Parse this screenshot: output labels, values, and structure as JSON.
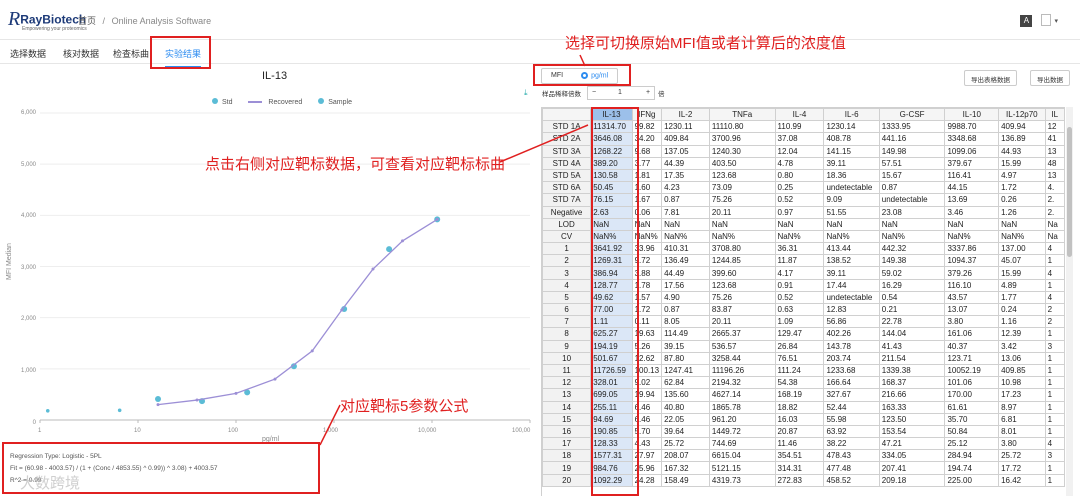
{
  "header": {
    "logo_brand": "RayBiotech",
    "logo_tagline": "Empowering your proteomics",
    "breadcrumb_home": "首页",
    "breadcrumb_sep": "/",
    "breadcrumb_page": "Online Analysis Software",
    "lang_icon": "A"
  },
  "tabs": [
    {
      "label": "选择数据"
    },
    {
      "label": "核对数据"
    },
    {
      "label": "检查标曲"
    },
    {
      "label": "实验结果"
    }
  ],
  "annotations": {
    "top": "选择可切换原始MFI值或者计算后的浓度值",
    "middle": "点击右侧对应靶标数据，可查看对应靶标标曲",
    "bottom": "对应靶标5参数公式"
  },
  "chart": {
    "title": "IL-13",
    "legend": [
      "Std",
      "Recovered",
      "Sample"
    ],
    "ylabel": "MFI Median",
    "xlabel": "pg/ml",
    "yticks": [
      "6,000",
      "5,000",
      "4,000",
      "3,000",
      "2,000",
      "1,000",
      "0"
    ],
    "xticks": [
      "1",
      "10",
      "100",
      "1,000",
      "10,000",
      "100,00"
    ]
  },
  "chart_data": {
    "type": "scatter",
    "title": "IL-13",
    "xlabel": "pg/ml",
    "ylabel": "MFI Median",
    "xscale": "log",
    "xlim": [
      1,
      100000
    ],
    "ylim": [
      0,
      6000
    ],
    "legend": "top",
    "series": [
      {
        "name": "Std",
        "x": [
          16,
          45,
          130,
          390,
          1270,
          3650,
          11300
        ],
        "y": [
          410,
          370,
          540,
          1050,
          2170,
          3340,
          3920
        ]
      },
      {
        "name": "Sample",
        "x": [
          1.2,
          6.5
        ],
        "y": [
          180,
          190
        ]
      },
      {
        "name": "Recovered",
        "x": [
          16,
          40,
          100,
          250,
          600,
          1200,
          2500,
          5000,
          11300
        ],
        "y": [
          300,
          390,
          520,
          800,
          1350,
          2150,
          2950,
          3500,
          3920
        ]
      }
    ]
  },
  "regression": {
    "type": "Regression Type: Logistic - 5PL",
    "formula": "Fit = (60.98 - 4003.57) / (1 + (Conc / 4853.55) ^ 0.99)) ^ 3.08) + 4003.57",
    "r2": "R^2 = 0.99"
  },
  "toggle": {
    "mfi": "MFI",
    "conc": "pg/ml"
  },
  "buttons": {
    "export_table": "导出表格数据",
    "export_graph": "导出数据"
  },
  "dilution": {
    "label": "样品稀释倍数",
    "minus": "−",
    "value": "1",
    "plus": "+",
    "unit": "倍"
  },
  "table": {
    "columns": [
      "",
      "IL-13",
      "IFNg",
      "IL-2",
      "TNFa",
      "IL-4",
      "IL-6",
      "G-CSF",
      "IL-10",
      "IL-12p70",
      "IL"
    ],
    "rows": [
      [
        "STD 1A",
        "11314.70",
        "99.82",
        "1230.11",
        "11110.80",
        "110.99",
        "1230.14",
        "1333.95",
        "9988.70",
        "409.94",
        "12"
      ],
      [
        "STD 2A",
        "3646.08",
        "34.20",
        "409.84",
        "3700.96",
        "37.08",
        "408.78",
        "441.16",
        "3348.68",
        "136.89",
        "41"
      ],
      [
        "STD 3A",
        "1268.22",
        "9.68",
        "137.05",
        "1240.30",
        "12.04",
        "141.15",
        "149.98",
        "1099.06",
        "44.93",
        "13"
      ],
      [
        "STD 4A",
        "389.20",
        "3.77",
        "44.39",
        "403.50",
        "4.78",
        "39.11",
        "57.51",
        "379.67",
        "15.99",
        "48"
      ],
      [
        "STD 5A",
        "130.58",
        "1.81",
        "17.35",
        "123.68",
        "0.80",
        "18.36",
        "15.67",
        "116.41",
        "4.97",
        "13"
      ],
      [
        "STD 6A",
        "50.45",
        "1.60",
        "4.23",
        "73.09",
        "0.25",
        "undetectable",
        "0.87",
        "44.15",
        "1.72",
        "4."
      ],
      [
        "STD 7A",
        "76.15",
        "1.67",
        "0.87",
        "75.26",
        "0.52",
        "9.09",
        "undetectable",
        "13.69",
        "0.26",
        "2."
      ],
      [
        "Negative",
        "2.63",
        "0.06",
        "7.81",
        "20.11",
        "0.97",
        "51.55",
        "23.08",
        "3.46",
        "1.26",
        "2."
      ],
      [
        "LOD",
        "NaN",
        "NaN",
        "NaN",
        "NaN",
        "NaN",
        "NaN",
        "NaN",
        "NaN",
        "NaN",
        "Na"
      ],
      [
        "CV",
        "NaN%",
        "NaN%",
        "NaN%",
        "NaN%",
        "NaN%",
        "NaN%",
        "NaN%",
        "NaN%",
        "NaN%",
        "Na"
      ],
      [
        "1",
        "3641.92",
        "33.96",
        "410.31",
        "3708.80",
        "36.31",
        "413.44",
        "442.32",
        "3337.86",
        "137.00",
        "4"
      ],
      [
        "2",
        "1269.31",
        "9.72",
        "136.49",
        "1244.85",
        "11.87",
        "138.52",
        "149.38",
        "1094.37",
        "45.07",
        "1"
      ],
      [
        "3",
        "386.94",
        "3.88",
        "44.49",
        "399.60",
        "4.17",
        "39.11",
        "59.02",
        "379.26",
        "15.99",
        "4"
      ],
      [
        "4",
        "128.77",
        "1.78",
        "17.56",
        "123.68",
        "0.91",
        "17.44",
        "16.29",
        "116.10",
        "4.89",
        "1"
      ],
      [
        "5",
        "49.62",
        "1.57",
        "4.90",
        "75.26",
        "0.52",
        "undetectable",
        "0.54",
        "43.57",
        "1.77",
        "4"
      ],
      [
        "6",
        "77.00",
        "1.72",
        "0.87",
        "83.87",
        "0.63",
        "12.83",
        "0.21",
        "13.07",
        "0.24",
        "2"
      ],
      [
        "7",
        "1.11",
        "0.11",
        "8.05",
        "20.11",
        "1.09",
        "56.86",
        "22.78",
        "3.80",
        "1.16",
        "2"
      ],
      [
        "8",
        "625.27",
        "19.63",
        "114.49",
        "2665.37",
        "129.47",
        "402.26",
        "144.04",
        "161.06",
        "12.39",
        "1"
      ],
      [
        "9",
        "194.19",
        "5.26",
        "39.15",
        "536.57",
        "26.84",
        "143.78",
        "41.43",
        "40.37",
        "3.42",
        "3"
      ],
      [
        "10",
        "501.67",
        "12.62",
        "87.80",
        "3258.44",
        "76.51",
        "203.74",
        "211.54",
        "123.71",
        "13.06",
        "1"
      ],
      [
        "11",
        "11726.59",
        "100.13",
        "1247.41",
        "11196.26",
        "111.24",
        "1233.68",
        "1339.38",
        "10052.19",
        "409.85",
        "1"
      ],
      [
        "12",
        "328.01",
        "9.02",
        "62.84",
        "2194.32",
        "54.38",
        "166.64",
        "168.37",
        "101.06",
        "10.98",
        "1"
      ],
      [
        "13",
        "699.05",
        "19.94",
        "135.60",
        "4627.14",
        "168.19",
        "327.67",
        "216.66",
        "170.00",
        "17.23",
        "1"
      ],
      [
        "14",
        "255.11",
        "6.46",
        "40.80",
        "1865.78",
        "18.82",
        "52.44",
        "163.33",
        "61.61",
        "8.97",
        "1"
      ],
      [
        "15",
        "94.69",
        "6.46",
        "22.05",
        "961.20",
        "16.03",
        "55.98",
        "123.50",
        "35.70",
        "6.81",
        "1"
      ],
      [
        "16",
        "190.85",
        "5.70",
        "39.64",
        "1449.72",
        "20.87",
        "63.92",
        "153.54",
        "50.84",
        "8.01",
        "1"
      ],
      [
        "17",
        "128.33",
        "4.43",
        "25.72",
        "744.69",
        "11.46",
        "38.22",
        "47.21",
        "25.12",
        "3.80",
        "4"
      ],
      [
        "18",
        "1577.31",
        "27.97",
        "208.07",
        "6615.04",
        "354.51",
        "478.43",
        "334.05",
        "284.94",
        "25.72",
        "3"
      ],
      [
        "19",
        "984.76",
        "25.96",
        "167.32",
        "5121.15",
        "314.31",
        "477.48",
        "207.41",
        "194.74",
        "17.72",
        "1"
      ],
      [
        "20",
        "1092.29",
        "24.28",
        "158.49",
        "4319.73",
        "272.83",
        "458.52",
        "209.18",
        "225.00",
        "16.42",
        "1"
      ]
    ]
  },
  "watermark": "大数跨境",
  "colors": {
    "accent": "#2d8cf0",
    "annotation": "#e02020",
    "std": "#5bbcd6",
    "curve": "#9c8fd6",
    "highlight": "#9cc0ea"
  }
}
